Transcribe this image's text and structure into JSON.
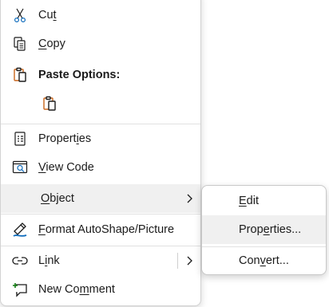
{
  "colors": {
    "accent": "#0f6cbd",
    "paste_orange": "#c8651b",
    "hover": "#f0f0f0",
    "text": "#1b1b1b"
  },
  "context_menu": {
    "items": [
      {
        "id": "cut",
        "icon": "scissors-icon",
        "pre": "Cu",
        "key": "t",
        "post": ""
      },
      {
        "id": "copy",
        "icon": "copy-icon",
        "pre": "",
        "key": "C",
        "post": "opy"
      },
      {
        "id": "paste_options",
        "icon": "paste-icon",
        "label": "Paste Options:"
      },
      {
        "id": "paste_option_1",
        "icon": "paste-keep-source-icon"
      },
      {
        "id": "properties",
        "icon": "properties-icon",
        "pre": "Propert",
        "key": "i",
        "post": "es"
      },
      {
        "id": "view_code",
        "icon": "view-code-icon",
        "pre": "",
        "key": "V",
        "post": "iew Code"
      },
      {
        "id": "object",
        "pre": "",
        "key": "O",
        "post": "bject",
        "has_submenu": true,
        "highlighted": true
      },
      {
        "id": "format_autoshape",
        "icon": "format-shape-icon",
        "pre": "",
        "key": "F",
        "post": "ormat AutoShape/Picture"
      },
      {
        "id": "link",
        "icon": "link-icon",
        "pre": "L",
        "key": "i",
        "post": "nk",
        "has_submenu": true
      },
      {
        "id": "new_comment",
        "icon": "new-comment-icon",
        "pre": "New Co",
        "key": "m",
        "post": "ment"
      }
    ]
  },
  "object_submenu": {
    "items": [
      {
        "id": "edit",
        "pre": "",
        "key": "E",
        "post": "dit"
      },
      {
        "id": "properties",
        "pre": "Prop",
        "key": "e",
        "post": "rties...",
        "highlighted": true
      },
      {
        "id": "convert",
        "pre": "Con",
        "key": "v",
        "post": "ert..."
      }
    ]
  }
}
